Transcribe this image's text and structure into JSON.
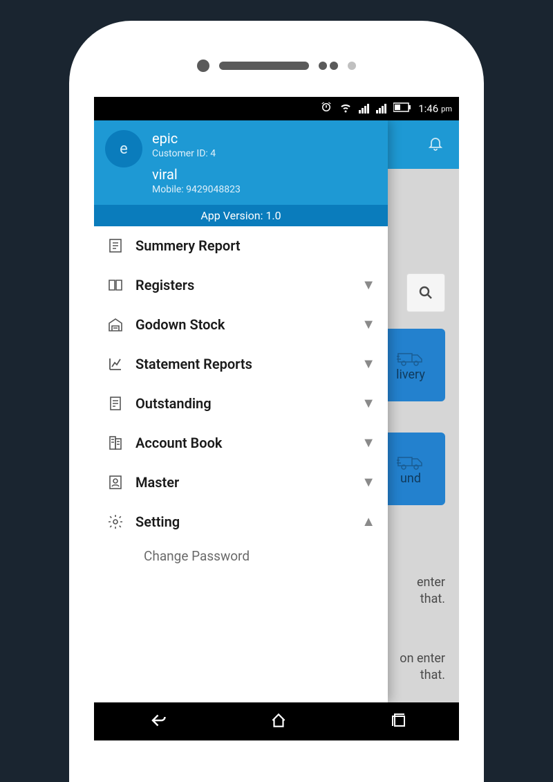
{
  "status": {
    "time": "1:46",
    "period": "pm"
  },
  "drawer": {
    "avatar_letter": "e",
    "company": "epic",
    "customer_id_label": "Customer ID: 4",
    "user": "viral",
    "mobile_label": "Mobile: 9429048823",
    "version": "App Version: 1.0",
    "items": [
      {
        "label": "Summery Report",
        "icon": "report",
        "expandable": false
      },
      {
        "label": "Registers",
        "icon": "book-open",
        "expandable": true,
        "expanded": false
      },
      {
        "label": "Godown Stock",
        "icon": "warehouse",
        "expandable": true,
        "expanded": false
      },
      {
        "label": "Statement Reports",
        "icon": "chart",
        "expandable": true,
        "expanded": false
      },
      {
        "label": "Outstanding",
        "icon": "receipt",
        "expandable": true,
        "expanded": false
      },
      {
        "label": "Account Book",
        "icon": "ledger",
        "expandable": true,
        "expanded": false
      },
      {
        "label": "Master",
        "icon": "contact",
        "expandable": true,
        "expanded": false
      },
      {
        "label": "Setting",
        "icon": "gear",
        "expandable": true,
        "expanded": true
      }
    ],
    "setting_sub": "Change Password"
  },
  "background": {
    "card1": "livery",
    "card2": "und",
    "hint1a": "enter",
    "hint1b": "that.",
    "hint2a": "on enter",
    "hint2b": "that."
  }
}
